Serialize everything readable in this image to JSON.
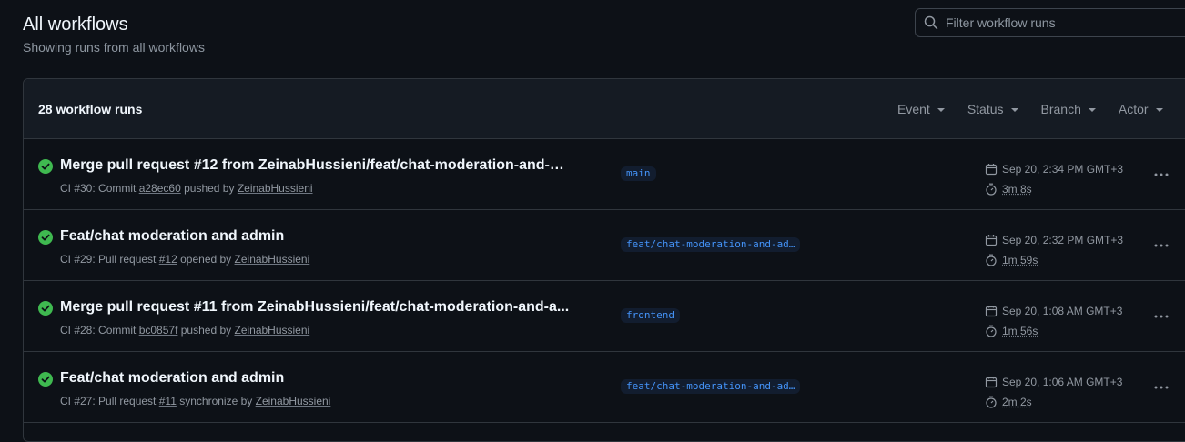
{
  "header": {
    "title": "All workflows",
    "subtitle": "Showing runs from all workflows"
  },
  "search": {
    "placeholder": "Filter workflow runs",
    "value": ""
  },
  "list": {
    "count_label": "28 workflow runs",
    "filters": [
      {
        "label": "Event"
      },
      {
        "label": "Status"
      },
      {
        "label": "Branch"
      },
      {
        "label": "Actor"
      }
    ]
  },
  "runs": [
    {
      "title": "Merge pull request #12 from ZeinabHussieni/feat/chat-moderation-and-a...",
      "status": "success",
      "meta": {
        "prefix": "CI #30: Commit",
        "ref": "a28ec60",
        "middle": "pushed by",
        "actor": "ZeinabHussieni"
      },
      "branch": "main",
      "date": "Sep 20, 2:34 PM GMT+3",
      "duration": "3m 8s"
    },
    {
      "title": "Feat/chat moderation and admin",
      "status": "success",
      "meta": {
        "prefix": "CI #29: Pull request",
        "ref": "#12",
        "middle": "opened by",
        "actor": "ZeinabHussieni"
      },
      "branch": "feat/chat-moderation-and-ad…",
      "date": "Sep 20, 2:32 PM GMT+3",
      "duration": "1m 59s"
    },
    {
      "title": "Merge pull request #11 from ZeinabHussieni/feat/chat-moderation-and-a...",
      "status": "success",
      "meta": {
        "prefix": "CI #28: Commit",
        "ref": "bc0857f",
        "middle": "pushed by",
        "actor": "ZeinabHussieni"
      },
      "branch": "frontend",
      "date": "Sep 20, 1:08 AM GMT+3",
      "duration": "1m 56s"
    },
    {
      "title": "Feat/chat moderation and admin",
      "status": "success",
      "meta": {
        "prefix": "CI #27: Pull request",
        "ref": "#11",
        "middle": "synchronize by",
        "actor": "ZeinabHussieni"
      },
      "branch": "feat/chat-moderation-and-ad…",
      "date": "Sep 20, 1:06 AM GMT+3",
      "duration": "2m 2s"
    }
  ],
  "colors": {
    "success": "#3fb950",
    "link": "#4493f8",
    "background": "#0d1117"
  }
}
